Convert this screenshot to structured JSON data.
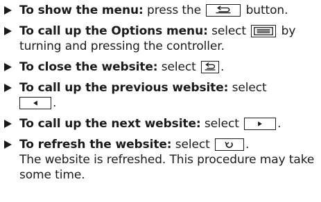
{
  "instructions": [
    {
      "label": "To show the menu:",
      "before_icon": "press the",
      "icon": "back-arrow-icon",
      "after_icon": "button."
    },
    {
      "label": "To call up the Options menu:",
      "before_icon": "select",
      "icon": "options-menu-icon",
      "after_icon": "by turning and pressing the controller."
    },
    {
      "label": "To close the website:",
      "before_icon": "select",
      "icon": "close-back-icon",
      "after_icon": "."
    },
    {
      "label": "To call up the previous website:",
      "before_icon": "select",
      "icon": "previous-arrow-icon",
      "after_icon": "."
    },
    {
      "label": "To call up the next website:",
      "before_icon": "select",
      "icon": "next-arrow-icon",
      "after_icon": "."
    },
    {
      "label": "To refresh the website:",
      "before_icon": "select",
      "icon": "refresh-icon",
      "after_icon": ".",
      "result": "The website is refreshed. This procedure may take some time."
    }
  ]
}
